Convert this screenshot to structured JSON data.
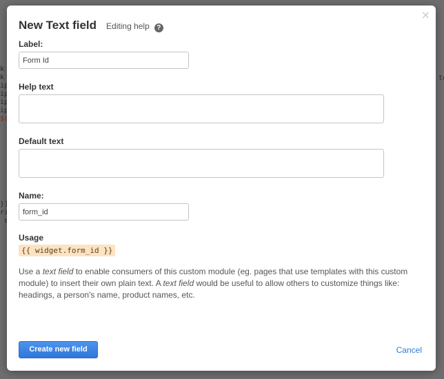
{
  "background": {
    "code_left_top": [
      "k",
      "k",
      "ip",
      "ip",
      "ip",
      "ip",
      "$("
    ],
    "code_left_bottom": [
      "}]",
      "ri",
      " s"
    ],
    "code_right": [
      "to"
    ]
  },
  "modal": {
    "title": "New Text field",
    "help_link": "Editing help",
    "help_icon_glyph": "?",
    "close_glyph": "×",
    "fields": {
      "label": {
        "label": "Label:",
        "value": "Form Id"
      },
      "help_text": {
        "label": "Help text",
        "value": ""
      },
      "default_text": {
        "label": "Default text",
        "value": ""
      },
      "name": {
        "label": "Name:",
        "value": "form_id"
      }
    },
    "usage": {
      "label": "Usage",
      "code": "{{ widget.form_id }}"
    },
    "description": {
      "p1": "Use a ",
      "em1": "text field",
      "p2": " to enable consumers of this custom module (eg. pages that use templates with this custom module) to insert their own plain text. A ",
      "em2": "text field",
      "p3": " would be useful to allow others to customize things like: headings, a person's name, product names, etc."
    },
    "buttons": {
      "create": "Create new field",
      "cancel": "Cancel"
    }
  },
  "colors": {
    "primary_button": "#2e76d9",
    "link": "#2d7bd1",
    "usage_highlight": "#fde3c1"
  }
}
